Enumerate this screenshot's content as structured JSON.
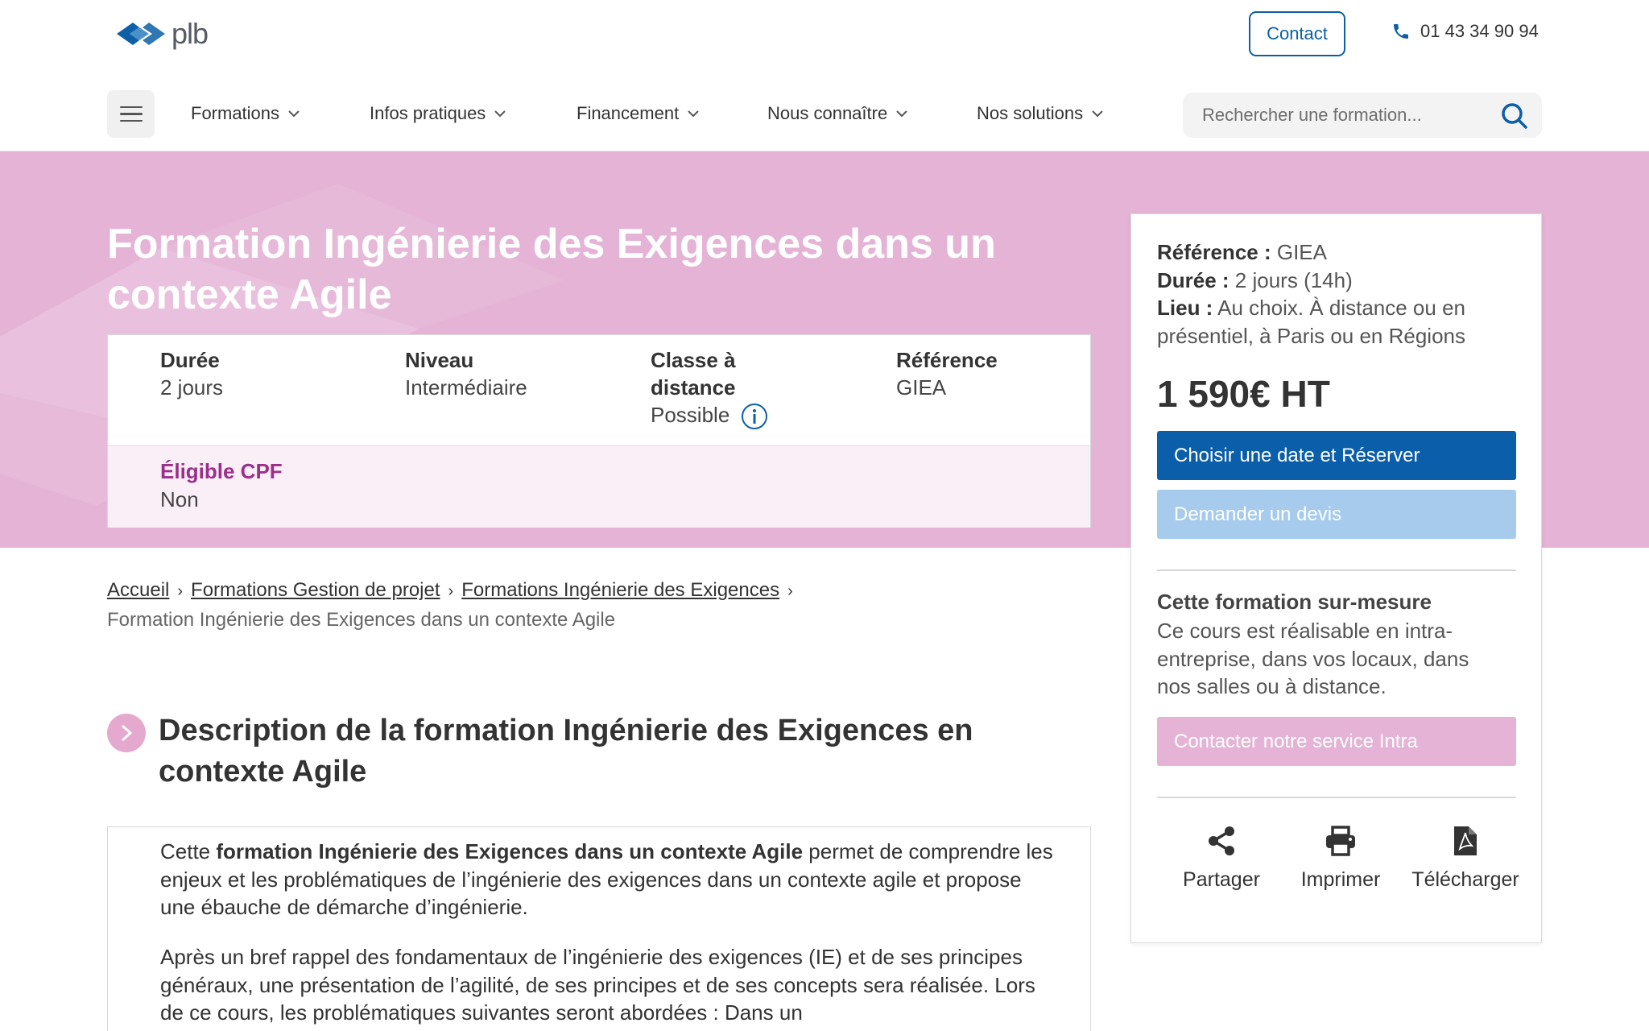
{
  "header": {
    "logo_text": "plb",
    "contact_label": "Contact",
    "phone": "01 43 34 90 94"
  },
  "nav": {
    "items": [
      {
        "label": "Formations"
      },
      {
        "label": "Infos pratiques"
      },
      {
        "label": "Financement"
      },
      {
        "label": "Nous connaître"
      },
      {
        "label": "Nos solutions"
      }
    ],
    "search_placeholder": "Rechercher une formation..."
  },
  "hero": {
    "title_line1": "Formation Ingénierie des Exigences dans un",
    "title_line2": "contexte Agile",
    "info": {
      "duree_label": "Durée",
      "duree_value": "2 jours",
      "niveau_label": "Niveau",
      "niveau_value": "Intermédiaire",
      "classe_label_1": "Classe à",
      "classe_label_2": "distance",
      "classe_value": "Possible",
      "reference_label": "Référence",
      "reference_value": "GIEA",
      "cpf_label": "Éligible CPF",
      "cpf_value": "Non"
    }
  },
  "card": {
    "reference_label": "Référence :",
    "reference_value": " GIEA",
    "duree_label": "Durée :",
    "duree_value": " 2 jours (14h)",
    "lieu_label": "Lieu :",
    "lieu_value": " Au choix. À distance ou en présentiel, à Paris ou en Régions",
    "price": "1 590€ HT",
    "reserve_label": "Choisir une date et Réserver",
    "devis_label": "Demander un devis",
    "sur_mesure_title": "Cette formation sur-mesure",
    "sur_mesure_text": "Ce cours est réalisable en intra-entreprise, dans vos locaux, dans nos salles ou à distance.",
    "intra_label": "Contacter notre service Intra",
    "actions": {
      "share": "Partager",
      "print": "Imprimer",
      "download": "Télécharger"
    }
  },
  "breadcrumb": {
    "home": "Accueil",
    "level1": "Formations Gestion de projet",
    "level2": "Formations Ingénierie des Exigences",
    "current": "Formation Ingénierie des Exigences dans un contexte Agile"
  },
  "section": {
    "title": "Description de la formation Ingénierie des Exigences en contexte Agile",
    "p1_before": "Cette ",
    "p1_bold": "formation Ingénierie des Exigences dans un contexte Agile",
    "p1_after": " permet de comprendre les enjeux et les problématiques de l’ingénierie des exigences dans un contexte agile et propose une ébauche de démarche d’ingénierie.",
    "p2": "Après un bref rappel des fondamentaux de l’ingénierie des exigences (IE) et de ses principes généraux, une présentation de l’agilité, de ses principes et de ses concepts sera réalisée. Lors de ce cours, les problématiques suivantes seront abordées : Dans un"
  },
  "colors": {
    "brand_blue": "#0a5eaa",
    "hero_pink": "#e5b3d6",
    "cpf_purple": "#9a2f8a",
    "devis_blue": "#a6cbed"
  },
  "icons": [
    "plb-logo-icon",
    "phone-icon",
    "menu-icon",
    "chevron-down-icon",
    "search-icon",
    "info-icon",
    "share-icon",
    "print-icon",
    "pdf-icon",
    "chevron-right-icon"
  ]
}
